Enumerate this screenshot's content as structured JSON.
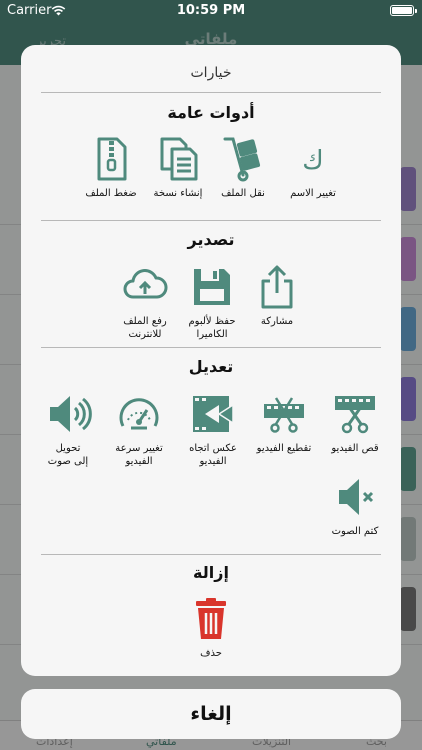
{
  "status_bar": {
    "carrier": "Carrier",
    "time": "10:59 PM"
  },
  "background": {
    "title": "ملفاتي",
    "edit_label": "تحرير",
    "tabs": [
      "إعدادات",
      "ملفاتي",
      "التنزيلات",
      "بحث"
    ]
  },
  "sheet": {
    "title": "خيارات",
    "sections": {
      "general": {
        "title": "أدوات عامة",
        "items": {
          "rename": "تغيير الاسم",
          "move": "نقل الملف",
          "copy": "إنشاء نسخة",
          "zip": "ضغط الملف"
        }
      },
      "export": {
        "title": "تصدير",
        "items": {
          "share": "مشاركة",
          "save_l1": "حفظ لألبوم",
          "save_l2": "الكاميرا",
          "upload_l1": "رفع الملف",
          "upload_l2": "للانترنت"
        }
      },
      "edit": {
        "title": "تعديل",
        "items": {
          "cut": "قص الفيديو",
          "trim": "تقطيع الفيديو",
          "reverse_l1": "عكس اتجاه",
          "reverse_l2": "الفيديو",
          "speed_l1": "تغيير سرعة",
          "speed_l2": "الفيديو",
          "audio_l1": "تحويل",
          "audio_l2": "إلى صوت",
          "mute": "كتم الصوت"
        }
      },
      "remove": {
        "title": "إزالة",
        "items": {
          "delete": "حذف"
        }
      }
    },
    "cancel_label": "إلغاء"
  },
  "colors": {
    "accent": "#4f8a7d",
    "icon": "#4f8a7d",
    "delete": "#d9352c"
  }
}
